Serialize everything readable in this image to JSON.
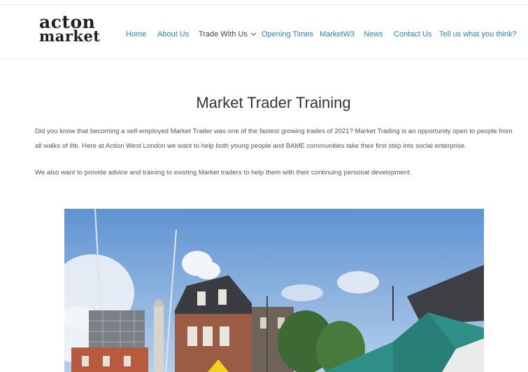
{
  "header": {
    "logo_line1": "acton",
    "logo_line2": "market",
    "nav": [
      {
        "label": "Home"
      },
      {
        "label": "About Us"
      },
      {
        "label": "Trade With Us"
      },
      {
        "label": "Opening Times"
      },
      {
        "label": "MarketW3"
      },
      {
        "label": "News"
      },
      {
        "label": "Contact Us"
      },
      {
        "label": "Tell us what you think?"
      }
    ]
  },
  "main": {
    "title": "Market Trader Training",
    "paragraph1": "Did you know that becoming a self-employed Market Trader was one of the fastest growing trades of 2021?  Market Trading is an opportunity open to people from all walks of life. Here at Action West London we want to help both young people and BAME communities take their first step into social enterprise.",
    "paragraph2": "We also want to provide advice and training to existing Market traders to help them with their continuing personal development."
  },
  "colors": {
    "nav_link": "#2b80c2",
    "sky": "#8fb8e4",
    "canopy": "#2e8f87"
  }
}
